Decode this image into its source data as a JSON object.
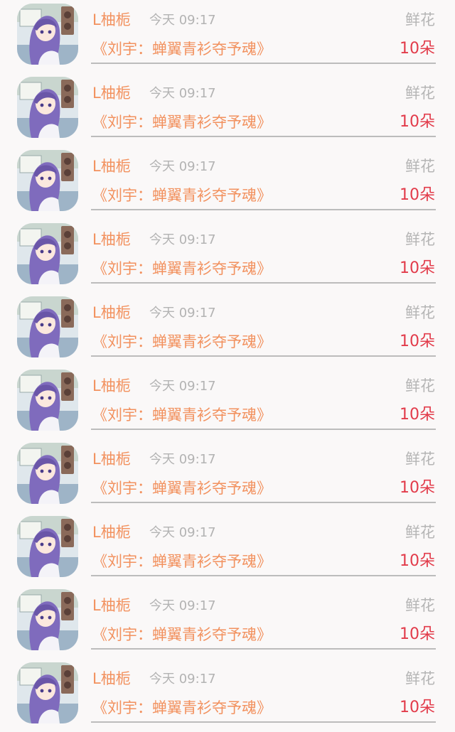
{
  "records": [
    {
      "user_name": "L柚栀",
      "time": "今天 09:17",
      "work_title": "《刘宇：蝉翼青衫夺予魂》",
      "gift_type": "鲜花",
      "gift_count": "10朵"
    },
    {
      "user_name": "L柚栀",
      "time": "今天 09:17",
      "work_title": "《刘宇：蝉翼青衫夺予魂》",
      "gift_type": "鲜花",
      "gift_count": "10朵"
    },
    {
      "user_name": "L柚栀",
      "time": "今天 09:17",
      "work_title": "《刘宇：蝉翼青衫夺予魂》",
      "gift_type": "鲜花",
      "gift_count": "10朵"
    },
    {
      "user_name": "L柚栀",
      "time": "今天 09:17",
      "work_title": "《刘宇：蝉翼青衫夺予魂》",
      "gift_type": "鲜花",
      "gift_count": "10朵"
    },
    {
      "user_name": "L柚栀",
      "time": "今天 09:17",
      "work_title": "《刘宇：蝉翼青衫夺予魂》",
      "gift_type": "鲜花",
      "gift_count": "10朵"
    },
    {
      "user_name": "L柚栀",
      "time": "今天 09:17",
      "work_title": "《刘宇：蝉翼青衫夺予魂》",
      "gift_type": "鲜花",
      "gift_count": "10朵"
    },
    {
      "user_name": "L柚栀",
      "time": "今天 09:17",
      "work_title": "《刘宇：蝉翼青衫夺予魂》",
      "gift_type": "鲜花",
      "gift_count": "10朵"
    },
    {
      "user_name": "L柚栀",
      "time": "今天 09:17",
      "work_title": "《刘宇：蝉翼青衫夺予魂》",
      "gift_type": "鲜花",
      "gift_count": "10朵"
    },
    {
      "user_name": "L柚栀",
      "time": "今天 09:17",
      "work_title": "《刘宇：蝉翼青衫夺予魂》",
      "gift_type": "鲜花",
      "gift_count": "10朵"
    },
    {
      "user_name": "L柚栀",
      "time": "今天 09:17",
      "work_title": "《刘宇：蝉翼青衫夺予魂》",
      "gift_type": "鲜花",
      "gift_count": "10朵"
    }
  ],
  "colors": {
    "background": "#faf8f8",
    "accent_orange": "#f2915e",
    "count_red": "#e23b4a",
    "muted_gray": "#b3b3b3",
    "divider": "#bcbcbc"
  },
  "avatar_icon": "anime-girl-avatar-icon"
}
